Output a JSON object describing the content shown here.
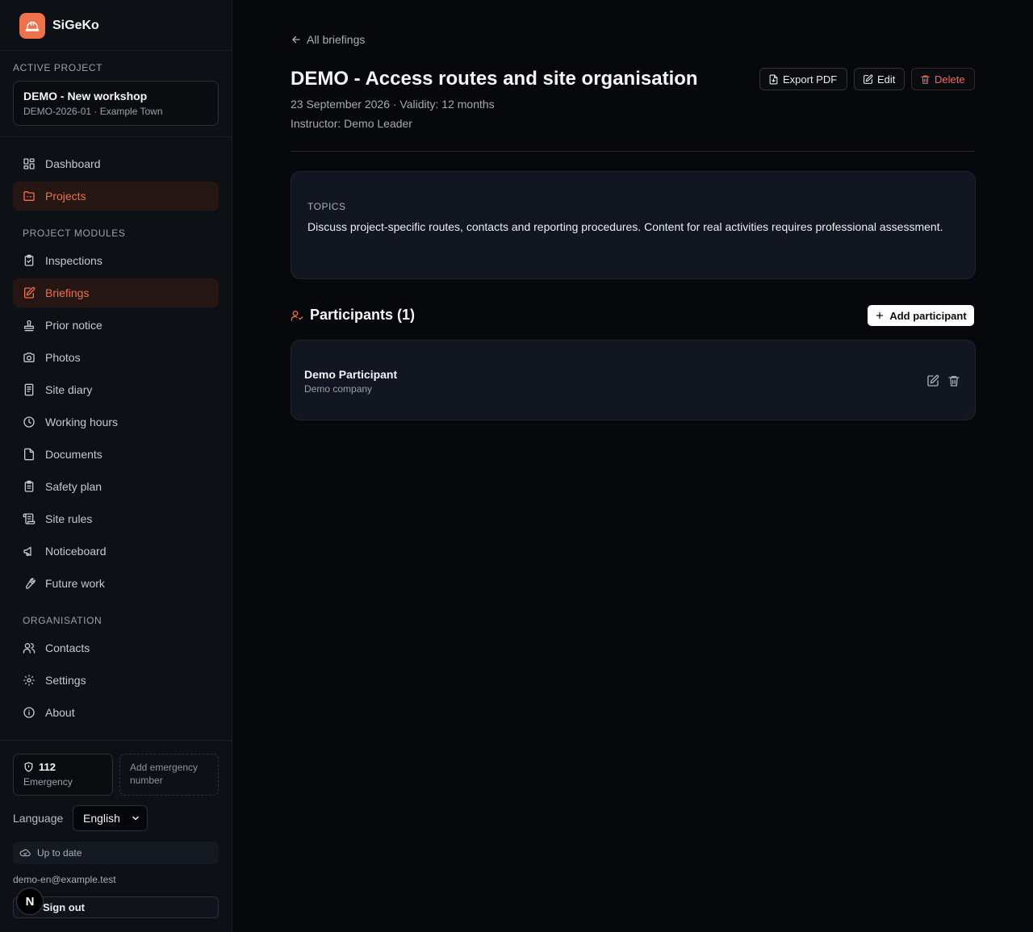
{
  "app": {
    "name": "SiGeKo",
    "accent": "#ef7049"
  },
  "sidebar": {
    "active_project_label": "ACTIVE PROJECT",
    "project": {
      "name": "DEMO - New workshop",
      "sub": "DEMO-2026-01 · Example Town"
    },
    "nav_top": [
      {
        "label": "Dashboard",
        "icon": "dashboard-icon"
      },
      {
        "label": "Projects",
        "icon": "folder-icon",
        "active": true
      }
    ],
    "modules_label": "PROJECT MODULES",
    "modules": [
      {
        "label": "Inspections",
        "icon": "clipboard-check-icon"
      },
      {
        "label": "Briefings",
        "icon": "edit-note-icon",
        "active": true
      },
      {
        "label": "Prior notice",
        "icon": "stamp-icon"
      },
      {
        "label": "Photos",
        "icon": "camera-icon"
      },
      {
        "label": "Site diary",
        "icon": "notebook-icon"
      },
      {
        "label": "Working hours",
        "icon": "clock-icon"
      },
      {
        "label": "Documents",
        "icon": "file-icon"
      },
      {
        "label": "Safety plan",
        "icon": "clipboard-list-icon"
      },
      {
        "label": "Site rules",
        "icon": "scroll-icon"
      },
      {
        "label": "Noticeboard",
        "icon": "megaphone-icon"
      },
      {
        "label": "Future work",
        "icon": "wrench-icon"
      }
    ],
    "org_label": "ORGANISATION",
    "org": [
      {
        "label": "Contacts",
        "icon": "users-icon"
      },
      {
        "label": "Settings",
        "icon": "gear-icon"
      },
      {
        "label": "About",
        "icon": "info-icon"
      }
    ],
    "emergency": {
      "number": "112",
      "label": "Emergency",
      "add_label": "Add emergency number"
    },
    "language": {
      "label": "Language",
      "value": "English"
    },
    "sync_status": "Up to date",
    "email": "demo-en@example.test",
    "sign_out": "Sign out",
    "badge_letter": "N"
  },
  "main": {
    "back_label": "All briefings",
    "title": "DEMO - Access routes and site organisation",
    "meta_line1": "23 September 2026 · Validity: 12 months",
    "meta_line2": "Instructor: Demo Leader",
    "actions": {
      "export": "Export PDF",
      "edit": "Edit",
      "delete": "Delete"
    },
    "topics": {
      "label": "TOPICS",
      "text": "Discuss project-specific routes, contacts and reporting procedures. Content for real activities requires professional assessment."
    },
    "participants": {
      "title": "Participants (1)",
      "add_label": "Add participant",
      "items": [
        {
          "name": "Demo Participant",
          "company": "Demo company"
        }
      ]
    }
  }
}
